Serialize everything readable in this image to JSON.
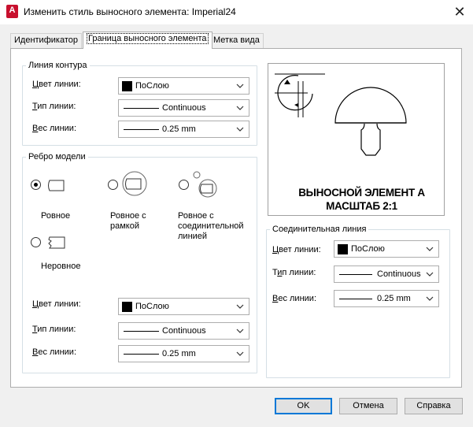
{
  "window": {
    "title": "Изменить стиль выносного элемента: Imperial24",
    "app_icon_letter": "A",
    "close_glyph": "✕"
  },
  "tabs": [
    {
      "label": "Идентификатор",
      "active": false
    },
    {
      "label": "Граница выносного элемента",
      "active": true
    },
    {
      "label": "Метка вида",
      "active": false
    }
  ],
  "contour_line": {
    "group_label": "Линия контура",
    "color": {
      "label_u": "Ц",
      "label_rest": "вет линии:",
      "value": "ПоСлою"
    },
    "type": {
      "label_u": "Т",
      "label_rest": "ип линии:",
      "value": "Continuous"
    },
    "weight": {
      "label_u": "В",
      "label_rest": "ес линии:",
      "value": "0.25 mm"
    }
  },
  "model_edge": {
    "group_label": "Ребро модели",
    "options": [
      {
        "label": "Ровное",
        "checked": true
      },
      {
        "label": "Ровное с рамкой",
        "checked": false
      },
      {
        "label": "Ровное с соединительной линией",
        "checked": false
      },
      {
        "label": "Неровное",
        "checked": false
      }
    ],
    "labels_split": {
      "smooth": "Ровное",
      "smooth_border_1": "Ровное с",
      "smooth_border_2": "рамкой",
      "smooth_conn_1": "Ровное с",
      "smooth_conn_2": "соединительной",
      "smooth_conn_3": "линией",
      "jagged": "Неровное"
    },
    "color": {
      "label_u": "Ц",
      "label_rest": "вет линии:",
      "value": "ПоСлою"
    },
    "type": {
      "label_u": "Т",
      "label_rest": "ип линии:",
      "value": "Continuous"
    },
    "weight": {
      "label_u": "В",
      "label_rest": "ес линии:",
      "value": "0.25 mm"
    }
  },
  "preview": {
    "line1": "ВЫНОСНОЙ ЭЛЕМЕНТ А",
    "line2": "МАСШТАБ 2:1"
  },
  "connection_line": {
    "group_label": "Соединительная линия",
    "color": {
      "label_u": "Ц",
      "label_rest": "вет линии:",
      "value": "ПоСлою"
    },
    "type": {
      "label_u": "и",
      "label_pre": "Т",
      "label_rest": "п линии:",
      "value": "Continuous"
    },
    "weight": {
      "label_u": "В",
      "label_rest": "ес линии:",
      "value": "0.25 mm"
    }
  },
  "buttons": {
    "ok": "OK",
    "cancel": "Отмена",
    "help": "Справка"
  }
}
